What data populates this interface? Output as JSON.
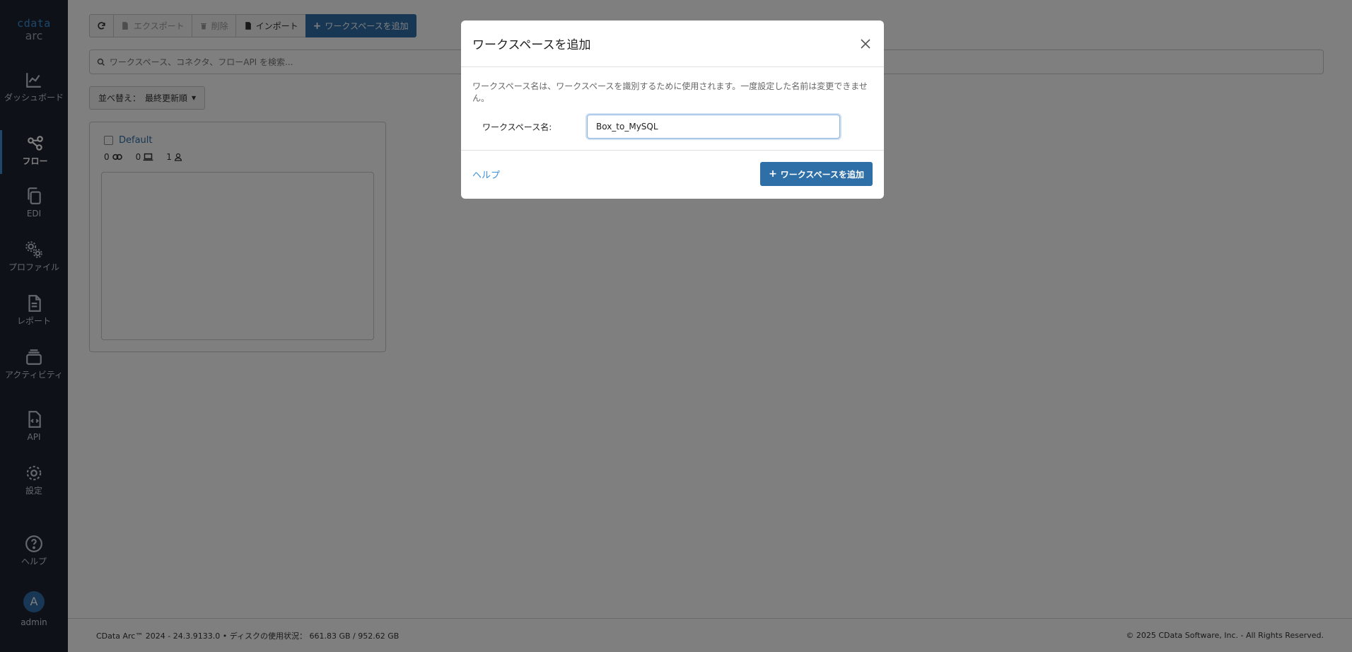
{
  "app": {
    "logo_word": "cdata",
    "logo_product": "arc"
  },
  "sidebar": {
    "items": [
      {
        "label": "ダッシュボード",
        "icon": "chart-line-icon"
      },
      {
        "label": "フロー",
        "icon": "share-nodes-icon",
        "active": true
      },
      {
        "label": "EDI",
        "icon": "copy-icon"
      },
      {
        "label": "プロファイル",
        "icon": "gears-icon"
      },
      {
        "label": "レポート",
        "icon": "file-text-icon"
      },
      {
        "label": "アクティビティ",
        "icon": "layers-icon"
      },
      {
        "label": "API",
        "icon": "file-code-icon"
      },
      {
        "label": "設定",
        "icon": "gear-icon"
      }
    ],
    "help_label": "ヘルプ",
    "user": {
      "avatar_letter": "A",
      "name": "admin"
    }
  },
  "toolbar": {
    "refresh_title": "refresh",
    "export_label": "エクスポート",
    "delete_label": "削除",
    "import_label": "インポート",
    "add_workspace_label": "ワークスペースを追加"
  },
  "search": {
    "placeholder": "ワークスペース、コネクタ、フローAPI を検索..."
  },
  "sort": {
    "label": "並べ替え：",
    "value": "最終更新順"
  },
  "workspace_card": {
    "name": "Default",
    "flows": "0",
    "connectors": "0",
    "users": "1"
  },
  "footer": {
    "version": "CData Arc™ 2024 - 24.3.9133.0",
    "disk_label": "ディスクの使用状況：",
    "disk_value": "661.83 GB / 952.62 GB",
    "copyright": "© 2025 CData Software, Inc. - All Rights Reserved."
  },
  "modal": {
    "title": "ワークスペースを追加",
    "description": "ワークスペース名は、ワークスペースを識別するために使用されます。一度設定した名前は変更できません。",
    "field_label": "ワークスペース名:",
    "field_value": "Box_to_MySQL",
    "help_link": "ヘルプ",
    "submit_label": "ワークスペースを追加"
  },
  "colors": {
    "primary": "#2f6fa8",
    "sidebar_bg": "#1c2530",
    "link": "#3b8fd6"
  }
}
